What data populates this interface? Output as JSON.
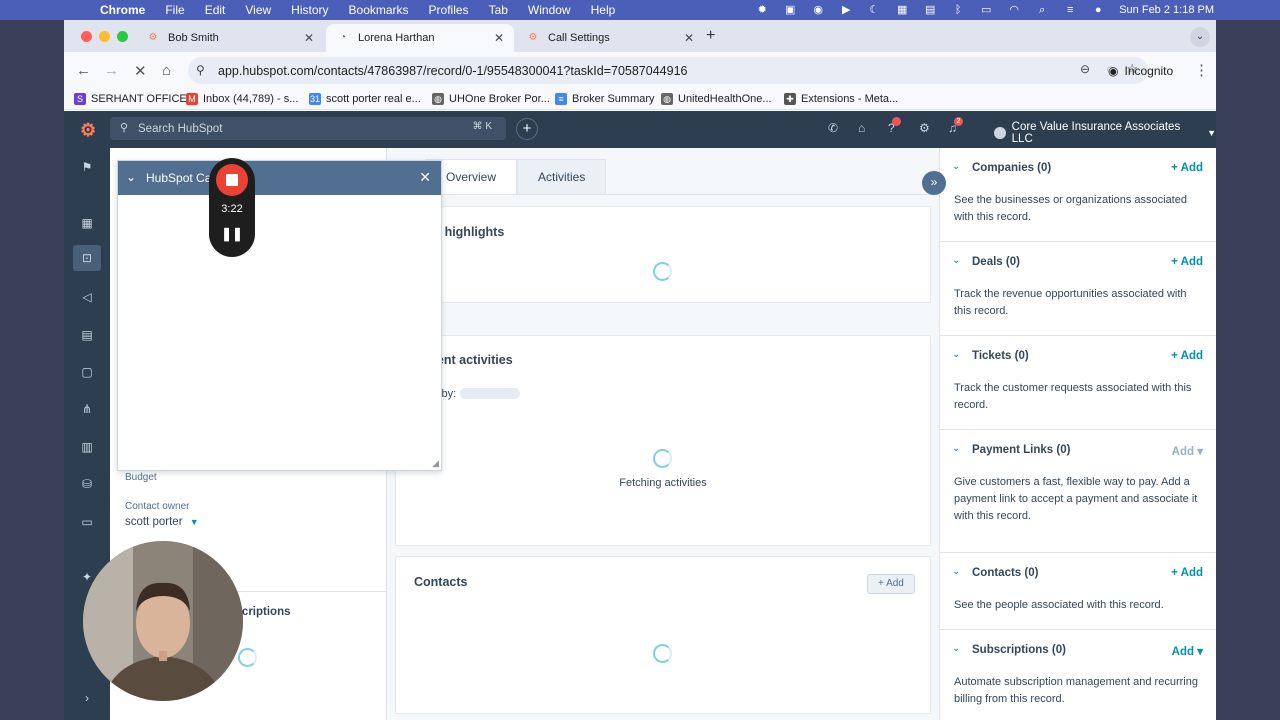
{
  "menubar": {
    "apple": "",
    "app": "Chrome",
    "menus": [
      "File",
      "Edit",
      "View",
      "History",
      "Bookmarks",
      "Profiles",
      "Tab",
      "Window",
      "Help"
    ],
    "clock": "Sun Feb 2  1:18 PM"
  },
  "browser": {
    "tabs": [
      {
        "title": "Bob Smith",
        "icon": "hubspot-icon"
      },
      {
        "title": "Lorena Harthan",
        "icon": "loading-icon"
      },
      {
        "title": "Call Settings",
        "icon": "hubspot-icon"
      }
    ],
    "url": "app.hubspot.com/contacts/47863987/record/0-1/95548300041?taskId=70587044916",
    "incognito_label": "Incognito",
    "bookmarks": [
      {
        "label": "SERHANT OFFICE",
        "icon": "serhant-icon",
        "color": "#6a3fd6"
      },
      {
        "label": "Inbox (44,789) - s...",
        "icon": "gmail-icon",
        "color": "#ea4335"
      },
      {
        "label": "scott porter real e...",
        "icon": "calendar-icon",
        "color": "#4285f4"
      },
      {
        "label": "UHOne Broker Por...",
        "icon": "globe-icon",
        "color": "#666666"
      },
      {
        "label": "Broker Summary",
        "icon": "docs-icon",
        "color": "#4285f4"
      },
      {
        "label": "UnitedHealthOne...",
        "icon": "globe-icon",
        "color": "#666666"
      },
      {
        "label": "Extensions - Meta...",
        "icon": "puzzle-icon",
        "color": "#555555"
      }
    ]
  },
  "hubspot": {
    "search_placeholder": "Search HubSpot",
    "search_shortcut": "⌘ K",
    "account_name": "Core Value Insurance Associates LLC",
    "notification_count": "2",
    "record_tabs": [
      "Overview",
      "Activities"
    ],
    "highlights_title": "Data highlights",
    "activities_title": "Recent activities",
    "filter_by": "Filter by:",
    "fetching_text": "Fetching activities",
    "contacts_card_title": "Contacts",
    "contacts_add": "+ Add",
    "left": {
      "budget_label": "Budget",
      "owner_label": "Contact owner",
      "owner_value": "scott porter",
      "subscriptions_title": "Communication subscriptions"
    },
    "sidebar_sections": [
      {
        "title": "Companies (0)",
        "action": "+ Add",
        "desc": "See the businesses or organizations associated with this record."
      },
      {
        "title": "Deals (0)",
        "action": "+ Add",
        "desc": "Track the revenue opportunities associated with this record."
      },
      {
        "title": "Tickets (0)",
        "action": "+ Add",
        "desc": "Track the customer requests associated with this record."
      },
      {
        "title": "Payment Links (0)",
        "action": "Add ▾",
        "desc": "Give customers a fast, flexible way to pay. Add a payment link to accept a payment and associate it with this record."
      },
      {
        "title": "Contacts (0)",
        "action": "+ Add",
        "desc": "See the people associated with this record."
      },
      {
        "title": "Subscriptions (0)",
        "action": "Add ▾",
        "desc": "Automate subscription management and recurring billing from this record."
      }
    ]
  },
  "call_widget": {
    "title": "HubSpot Calling",
    "timer": "3:22"
  },
  "colors": {
    "hubspot_nav": "#2d3e50",
    "accent": "#0091ae",
    "record_red": "#ea4335"
  }
}
